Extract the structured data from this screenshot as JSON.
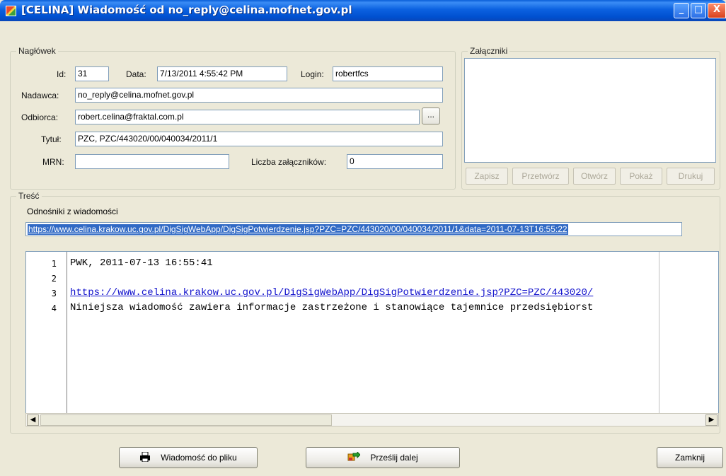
{
  "window": {
    "title": "[CELINA] Wiadomość od no_reply@celina.mofnet.gov.pl",
    "controls": {
      "minimize": "_",
      "maximize": "□",
      "close": "X"
    }
  },
  "header_group": {
    "title": "Nagłówek",
    "id_label": "Id:",
    "id_value": "31",
    "date_label": "Data:",
    "date_value": "7/13/2011 4:55:42 PM",
    "login_label": "Login:",
    "login_value": "robertfcs",
    "sender_label": "Nadawca:",
    "sender_value": "no_reply@celina.mofnet.gov.pl",
    "recipient_label": "Odbiorca:",
    "recipient_value": "robert.celina@fraktal.com.pl",
    "browse_label": "...",
    "subject_label": "Tytuł:",
    "subject_value": "PZC, PZC/443020/00/040034/2011/1",
    "mrn_label": "MRN:",
    "mrn_value": "",
    "attachments_count_label": "Liczba załączników:",
    "attachments_count_value": "0"
  },
  "attachments_group": {
    "title": "Załączniki",
    "buttons": [
      "Zapisz",
      "Przetwórz",
      "Otwórz",
      "Pokaż",
      "Drukuj"
    ]
  },
  "body_group": {
    "title": "Treść",
    "links_label": "Odnośniki z wiadomości",
    "link": "https://www.celina.krakow.uc.gov.pl/DigSigWebApp/DigSigPotwierdzenie.jsp?PZC=PZC/443020/00/040034/2011/1&data=2011-07-13T16:55:22",
    "lines": [
      {
        "num": "1",
        "text": "PWK, 2011-07-13 16:55:41"
      },
      {
        "num": "2",
        "text": ""
      },
      {
        "num": "3",
        "text": "https://www.celina.krakow.uc.gov.pl/DigSigWebApp/DigSigPotwierdzenie.jsp?PZC=PZC/443020/"
      },
      {
        "num": "4",
        "text": "Niniejsza wiadomość zawiera informacje zastrzeżone i stanowiące tajemnice przedsiębiorst"
      }
    ],
    "scroll_left": "◀",
    "scroll_right": "▶"
  },
  "footer": {
    "save_to_file": "Wiadomość do pliku",
    "forward": "Prześlij dalej",
    "close": "Zamknij"
  },
  "colors": {
    "titlebar": "#0b61e0",
    "window_bg": "#ece9d8",
    "selection": "#316ac5",
    "link": "#1010cc"
  }
}
